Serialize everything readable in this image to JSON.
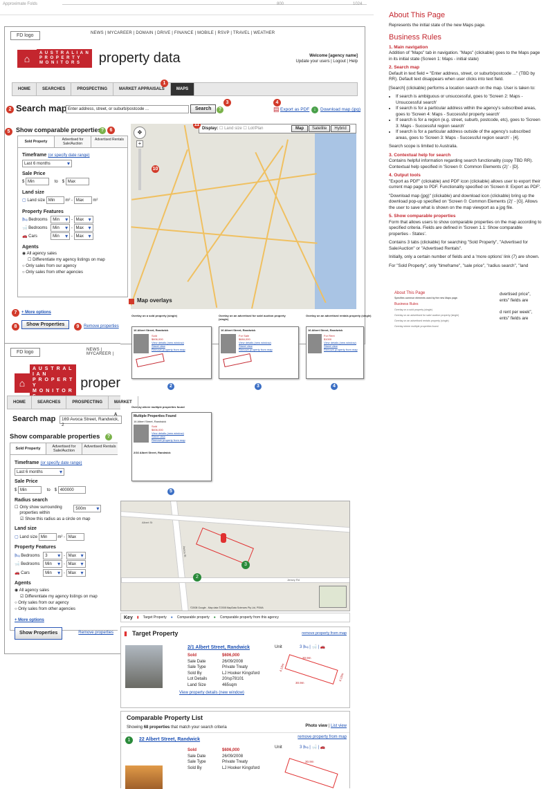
{
  "topbar": {
    "left": "Approximate Folds",
    "mid": "800",
    "right": "1024"
  },
  "global": {
    "logo_placeholder": "FD logo",
    "toplinks": "NEWS | MYCAREER | DOMAIN | DRIVE | FINANCE | MOBILE | RSVP | TRAVEL | WEATHER",
    "toplinks_short": "NEWS | MYCAREER |",
    "brand_lines": [
      "A U S T R A L I A N",
      "P R O P E R T Y",
      "M O N I T O R S"
    ],
    "product": "property data",
    "product_short": "proper",
    "welcome": "Welcome [agency name]",
    "account": "Update your users | Logout | Help",
    "tabs": [
      "HOME",
      "SEARCHES",
      "PROSPECTING",
      "MARKET APPRAISALS",
      "MAPS"
    ],
    "tabs_short": [
      "HOME",
      "SEARCHES",
      "PROSPECTING",
      "MARKET A"
    ]
  },
  "screen1": {
    "search_title": "Search map",
    "search_placeholder": "Enter address, street, or suburb/postcode ...",
    "search_button": "Search",
    "export_pdf": "Export as PDF",
    "download_map": "Download map (jpg)",
    "comparable_title": "Show comparable properties",
    "subtabs": [
      "Sold Property",
      "Advertised for Sale/Auction",
      "Advertised Rentals"
    ],
    "timeframe_label": "Timeframe",
    "timeframe_link": "(or specify date range)",
    "timeframe_value": "Last 6 months",
    "sale_price_label": "Sale Price",
    "price_min": "Min",
    "price_to": "to",
    "price_max": "Max",
    "land_size_label": "Land size",
    "land_size_row": "Land size",
    "land_min": "Min",
    "land_max": "Max",
    "land_unit": "m²",
    "features_label": "Property Features",
    "bedrooms": "Bedrooms",
    "bathrooms": "Bedrooms",
    "cars": "Cars",
    "min": "Min",
    "max": "Max",
    "agents_label": "Agents",
    "agent_all": "All agency sales",
    "agent_diff": "Differentiate my agency listings on map",
    "agent_ours": "Only sales from our agency",
    "agent_other": "Only sales from other agencies",
    "more_options": "+ More options",
    "show_btn": "Show Properties",
    "remove_link": "Remove properties",
    "display_label": "Display:",
    "display_land": "Land size",
    "display_lot": "Lot/Plan",
    "map_btns": [
      "Map",
      "Satellite",
      "Hybrid"
    ]
  },
  "overlays": {
    "title": "Map overlays",
    "o1": "Overlay on a sold property (single)",
    "o2": "Overlay on an advertised for sale/ auction property (single)",
    "o3": "Overlay on an advertised rentals property (single)",
    "o4": "Overlay where multiple properties found",
    "multi_title": "Multiple Properties Found",
    "addr": "16 Albert Street, Randwick",
    "addr2": "2/16 Albert Street, Randwick",
    "sold": "Sold",
    "for_sale": "For Sale",
    "for_rent": "For Rent",
    "price1": "$606,000",
    "price2": "$684,000",
    "price3": "$1000",
    "view_details": "View details (new window)",
    "street_view": "Street view",
    "remove": "Remove property from map"
  },
  "screen2": {
    "search_value": "169 Avoca Street, Randwick, 2",
    "price_min": "Min",
    "price_max": "400000",
    "radius_label": "Radius search",
    "radius_check": "Only show surrounding properties within",
    "radius_value": "500m",
    "radius_circle": "Show this radius as a circle on map",
    "bed_min": "3",
    "key_label": "Key",
    "key_target": "Target Property",
    "key_comp": "Comparable property",
    "key_agency": "Comparable property from this agency",
    "copyright": "©2008 Google - Map data ©2008 MapData Sciences Pty Ltd, PSMA",
    "street_labels": [
      "Albert St",
      "Avoca St",
      "Jersey Rd"
    ]
  },
  "target": {
    "heading": "Target Property",
    "remove": "remove property from map",
    "address": "2/1 Albert Street, Randwick",
    "unit": "Unit",
    "beds": "3",
    "status": "Sold",
    "price": "$606,000",
    "rows": [
      [
        "Sale Date",
        "26/09/2008"
      ],
      [
        "Sale Type",
        "Private Treaty"
      ],
      [
        "Sold By",
        "LJ Hooker Kingsford"
      ],
      [
        "Lot Details",
        "20/sp78101"
      ],
      [
        "Land Size",
        "465sqm"
      ]
    ],
    "details_link": "View property details (new window)",
    "plan_dims": [
      "30.9m",
      "30.9m",
      "4.15m",
      "4.15m"
    ]
  },
  "comparable": {
    "heading": "Comparable Property List",
    "summary_pre": "Showing",
    "summary_count": "68 properties",
    "summary_post": "that match your search criteria",
    "photo_view": "Photo view",
    "list_view": "List view",
    "remove": "remove property from map",
    "address": "22 Albert Street, Randwick",
    "unit": "Unit",
    "beds": "3",
    "status": "Sold",
    "price": "$606,000",
    "rows": [
      [
        "Sale Date",
        "26/09/2008"
      ],
      [
        "Sale Type",
        "Private Treaty"
      ],
      [
        "Sold By",
        "LJ Hooker Kingsford"
      ]
    ],
    "plan_dim": "30.9m"
  },
  "right": {
    "title": "About This Page",
    "intro": "Represents the initial state of the new Maps page.",
    "rules_title": "Business Rules",
    "r1_head": "1. Main navigation",
    "r1": "Addition of \"Maps\" tab in navigation. \"Maps\" (clickable) goes to the Maps page in its initial state (Screen 1: Maps - initial state)",
    "r2_head": "2. Search map",
    "r2": "Default in text field = \"Enter address, street, or suburb/postcode ...\" (TBD by RR). Default text disappears when user clicks into text field.",
    "r2b": "[Search] (clickable) performs a location search on the map. User is taken to:",
    "r2_items": [
      "If search is ambiguous or unsuccessful, goes to 'Screen 2: Maps - Unsuccessful search'",
      "If search is for a particular address within the agency's subscribed areas, goes to 'Screen 4: Maps - Successful property search'",
      "If search is for a region (e.g. street, suburb, postcode, etc), goes to 'Screen 3: Maps - Successful region search'",
      "If search is for a particular address outside of the agency's subscribed areas, goes to 'Screen 3: Maps - Successful region search' - [4]."
    ],
    "r2c": "Search scope is limited to Australia.",
    "r3_head": "3. Contextual help for search",
    "r3": "Contains helpful information regarding search functionality (copy TBD RR). Contextual help specified in 'Screen 0: Common Elements (2)' - [D].",
    "r4_head": "4. Output tools",
    "r4": "\"Export as PDF\" (clickable) and PDF icon (clickable) allows user to export their current map page to PDF. Functionality specified on 'Screen 8: Export as PDF'.",
    "r4b": "\"Download map (jpg)\" (clickable) and download icon (clickable) bring up the download pop-up specified on 'Screen 0: Common Elements (2)' - [G]. Allows the user to save what is shown on the map viewport as a jpg file.",
    "r5_head": "5. Show comparable properties",
    "r5": "Form that allows users to show comparable properties on the map according to specified criteria. Fields are defined in 'Screen 1.1: Show comparable properties - States'.",
    "r5b": "Contains 3 tabs (clickable) for searching \"Sold Property\", \"Advertised for Sale/Auction\" or \"Advertised Rentals\".",
    "r5c": "Initially, only a certain number of fields and a 'more options' link (7) are shown.",
    "r5d": "For \"Sold Property\", only \"timeframe\", \"sale price\", \"radius search\", \"land",
    "peek1": "dvertised price\",",
    "peek2": "ents\" fields are",
    "peek3": "d rent per week\",",
    "peek4": "ents\" fields are",
    "second_title": "About This Page",
    "second_intro": "Specifies common elements used by the new Maps page.",
    "second_rules": "Business Rules"
  }
}
